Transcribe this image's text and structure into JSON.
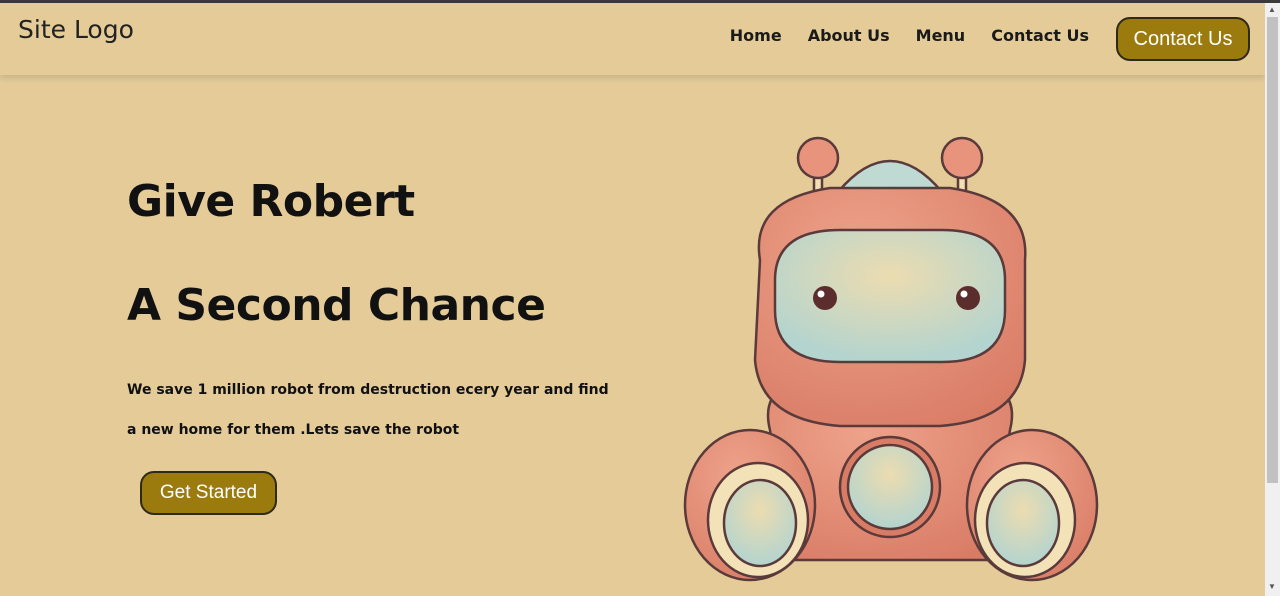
{
  "header": {
    "logo": "Site Logo",
    "nav": [
      "Home",
      "About Us",
      "Menu",
      "Contact Us"
    ],
    "cta_label": "Contact Us"
  },
  "hero": {
    "title_line1": "Give Robert",
    "title_line2": "A Second Chance",
    "desc_line1": "We save 1 million robot from destruction ecery year and find",
    "desc_line2": "a new home for them .Lets save the robot",
    "button_label": "Get Started"
  },
  "colors": {
    "background": "#e4cb98",
    "button": "#9b7a0e",
    "robot_body": "#e08a74",
    "robot_screen": "#b9d6cf"
  },
  "icons": [
    "robot-illustration",
    "scroll-up-arrow-icon",
    "scroll-down-arrow-icon"
  ]
}
